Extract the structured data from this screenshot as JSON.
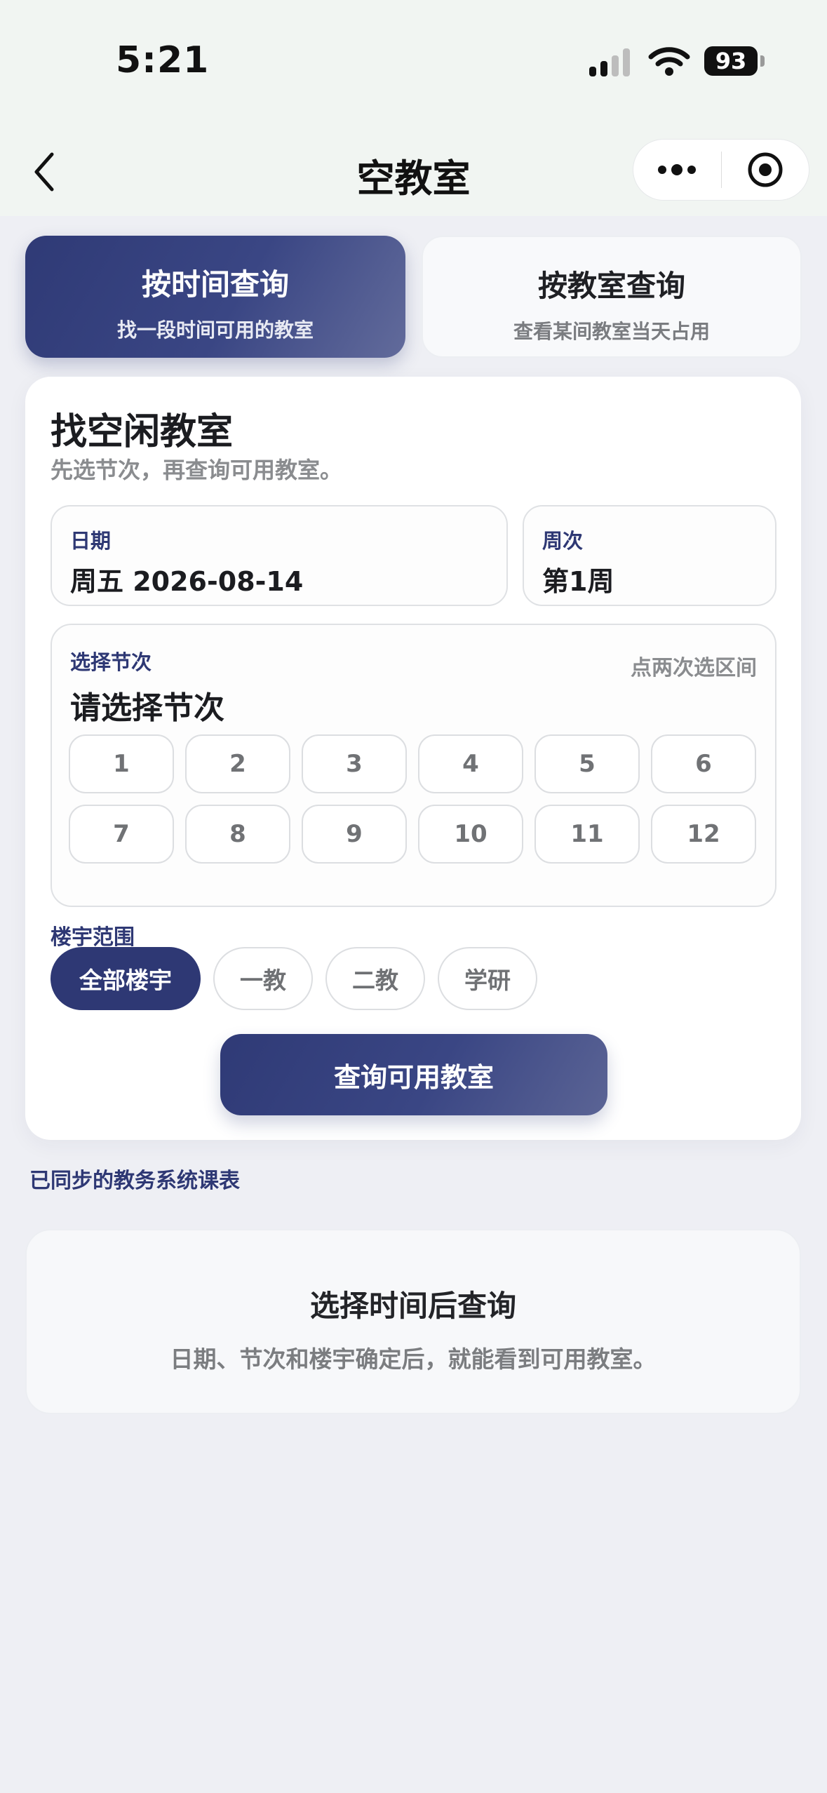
{
  "status_bar": {
    "time": "5:21",
    "battery": "93"
  },
  "nav": {
    "title": "空教室"
  },
  "tabs": [
    {
      "title": "按时间查询",
      "subtitle": "找一段时间可用的教室",
      "active": true
    },
    {
      "title": "按教室查询",
      "subtitle": "查看某间教室当天占用",
      "active": false
    }
  ],
  "card": {
    "title": "找空闲教室",
    "subtitle": "先选节次，再查询可用教室。",
    "date": {
      "label": "日期",
      "value": "周五 2026-08-14"
    },
    "week": {
      "label": "周次",
      "value": "第1周"
    },
    "slots": {
      "label": "选择节次",
      "hint": "点两次选区间",
      "placeholder": "请选择节次",
      "items": [
        "1",
        "2",
        "3",
        "4",
        "5",
        "6",
        "7",
        "8",
        "9",
        "10",
        "11",
        "12"
      ]
    },
    "buildings": {
      "label": "楼宇范围",
      "options": [
        "全部楼宇",
        "一教",
        "二教",
        "学研"
      ],
      "selected": "全部楼宇"
    },
    "query_button": "查询可用教室"
  },
  "synced_note": "已同步的教务系统课表",
  "empty_state": {
    "title": "选择时间后查询",
    "text": "日期、节次和楼宇确定后，就能看到可用教室。"
  },
  "colors": {
    "primary": "#2e3874",
    "background": "#eeeff4",
    "header": "#f1f5f2"
  }
}
